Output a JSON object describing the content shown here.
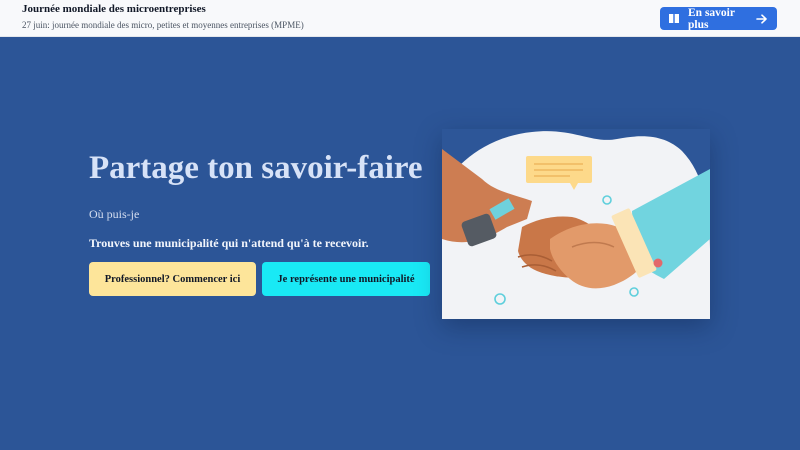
{
  "banner": {
    "title": "Journée mondiale des microentreprises",
    "subtitle": "27 juin: journée mondiale des micro, petites et moyennes entreprises (MPME)",
    "cta_label": "En savoir plus",
    "cta_icon": "book-icon",
    "cta_arrow_icon": "arrow-right-icon"
  },
  "hero": {
    "headline": "Partage ton savoir-faire",
    "subheading": "Où puis-je",
    "tagline": "Trouves une municipalité qui n'attend qu'à te recevoir.",
    "button_pro": "Professionnel? Commencer ici",
    "button_municipality": "Je représente une municipalité",
    "illustration": "handshake-illustration"
  },
  "colors": {
    "background": "#2c5597",
    "topbar": "#f8f9fb",
    "cta": "#2f6fe0",
    "button_pro": "#fde59a",
    "button_municipality": "#19e9f5"
  }
}
